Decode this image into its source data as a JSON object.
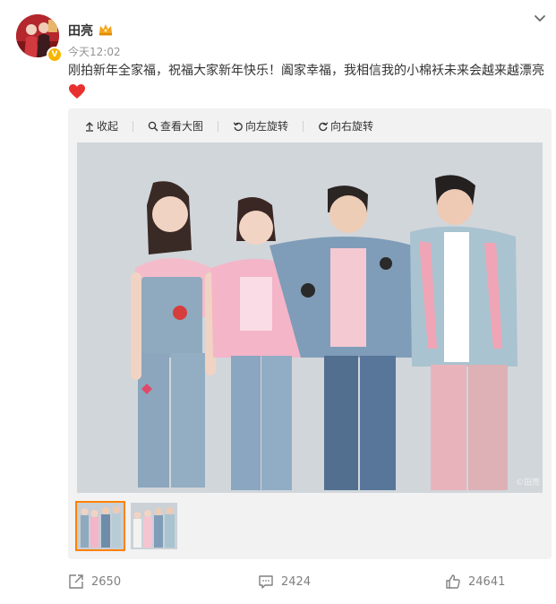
{
  "user": {
    "name": "田亮",
    "member_icon": "crown-member-icon",
    "verified_icon": "v-verified-icon",
    "verified_text": "V",
    "time": "今天12:02"
  },
  "post": {
    "text": "刚拍新年全家福，祝福大家新年快乐！阖家幸福，我相信我的小棉袄未来会越来越漂亮",
    "emoji": "heart-emoji"
  },
  "media_toolbar": {
    "collapse": "收起",
    "view_large": "查看大图",
    "rotate_left": "向左旋转",
    "rotate_right": "向右旋转"
  },
  "media": {
    "watermark": "©田亮",
    "thumbnails_count": 2,
    "selected_index": 0
  },
  "actions": {
    "repost_count": "2650",
    "comment_count": "2424",
    "like_count": "24641"
  },
  "colors": {
    "accent": "#ff8200",
    "text": "#333333",
    "muted": "#939393",
    "background": "#f2f2f2"
  }
}
